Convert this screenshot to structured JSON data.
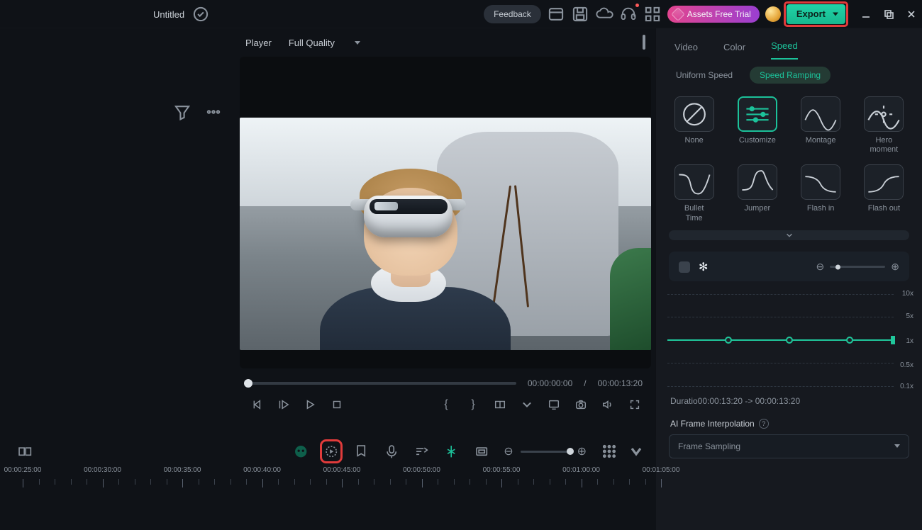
{
  "window": {
    "project_title": "Untitled",
    "feedback": "Feedback",
    "assets_trial": "Assets Free Trial",
    "export": "Export"
  },
  "player": {
    "label": "Player",
    "quality": "Full Quality",
    "timecode_current": "00:00:00:00",
    "timecode_sep": "/",
    "timecode_total": "00:00:13:20"
  },
  "inspector": {
    "tabs": [
      "Video",
      "Color",
      "Speed"
    ],
    "active_tab": "Speed",
    "speed_modes": {
      "uniform": "Uniform Speed",
      "ramping": "Speed Ramping"
    },
    "presets": [
      "None",
      "Customize",
      "Montage",
      "Hero\nmoment",
      "Bullet\nTime",
      "Jumper",
      "Flash in",
      "Flash out"
    ],
    "selected_preset": "Customize",
    "graph_scale": [
      "10x",
      "5x",
      "1x",
      "0.5x",
      "0.1x"
    ],
    "duration_text": "Duratio00:00:13:20 -> 00:00:13:20",
    "ai_label": "AI Frame Interpolation",
    "ai_mode": "Frame Sampling"
  },
  "timeline": {
    "labels": [
      "00:00:25:00",
      "00:00:30:00",
      "00:00:35:00",
      "00:00:40:00",
      "00:00:45:00",
      "00:00:50:00",
      "00:00:55:00",
      "00:01:00:00",
      "00:01:05:00"
    ]
  }
}
